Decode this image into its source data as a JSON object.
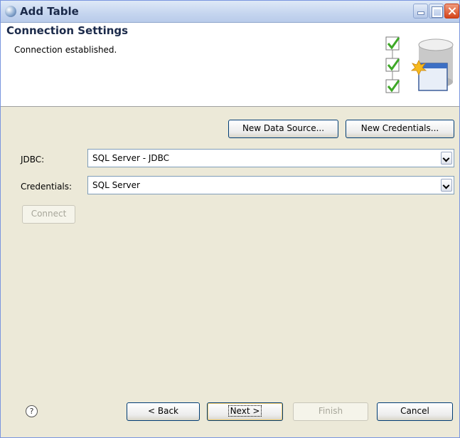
{
  "window": {
    "title": "Add Table"
  },
  "banner": {
    "title": "Connection Settings",
    "message": "Connection established."
  },
  "actions": {
    "new_data_source": "New Data Source...",
    "new_credentials": "New Credentials..."
  },
  "form": {
    "jdbc": {
      "label": "JDBC:",
      "value": "SQL Server - JDBC"
    },
    "credentials": {
      "label": "Credentials:",
      "value": "SQL Server"
    },
    "connect_label": "Connect"
  },
  "footer": {
    "help_glyph": "?",
    "back_label": "< Back",
    "next_label": "Next >",
    "finish_label": "Finish",
    "cancel_label": "Cancel"
  },
  "icons": {
    "app": "app-icon",
    "help": "help-icon",
    "wizard": "database-checklist-icon"
  },
  "colors": {
    "title_bar": "#c5d5ef",
    "panel": "#ece9d8",
    "close_button": "#d4441a",
    "button_border": "#003c74"
  }
}
